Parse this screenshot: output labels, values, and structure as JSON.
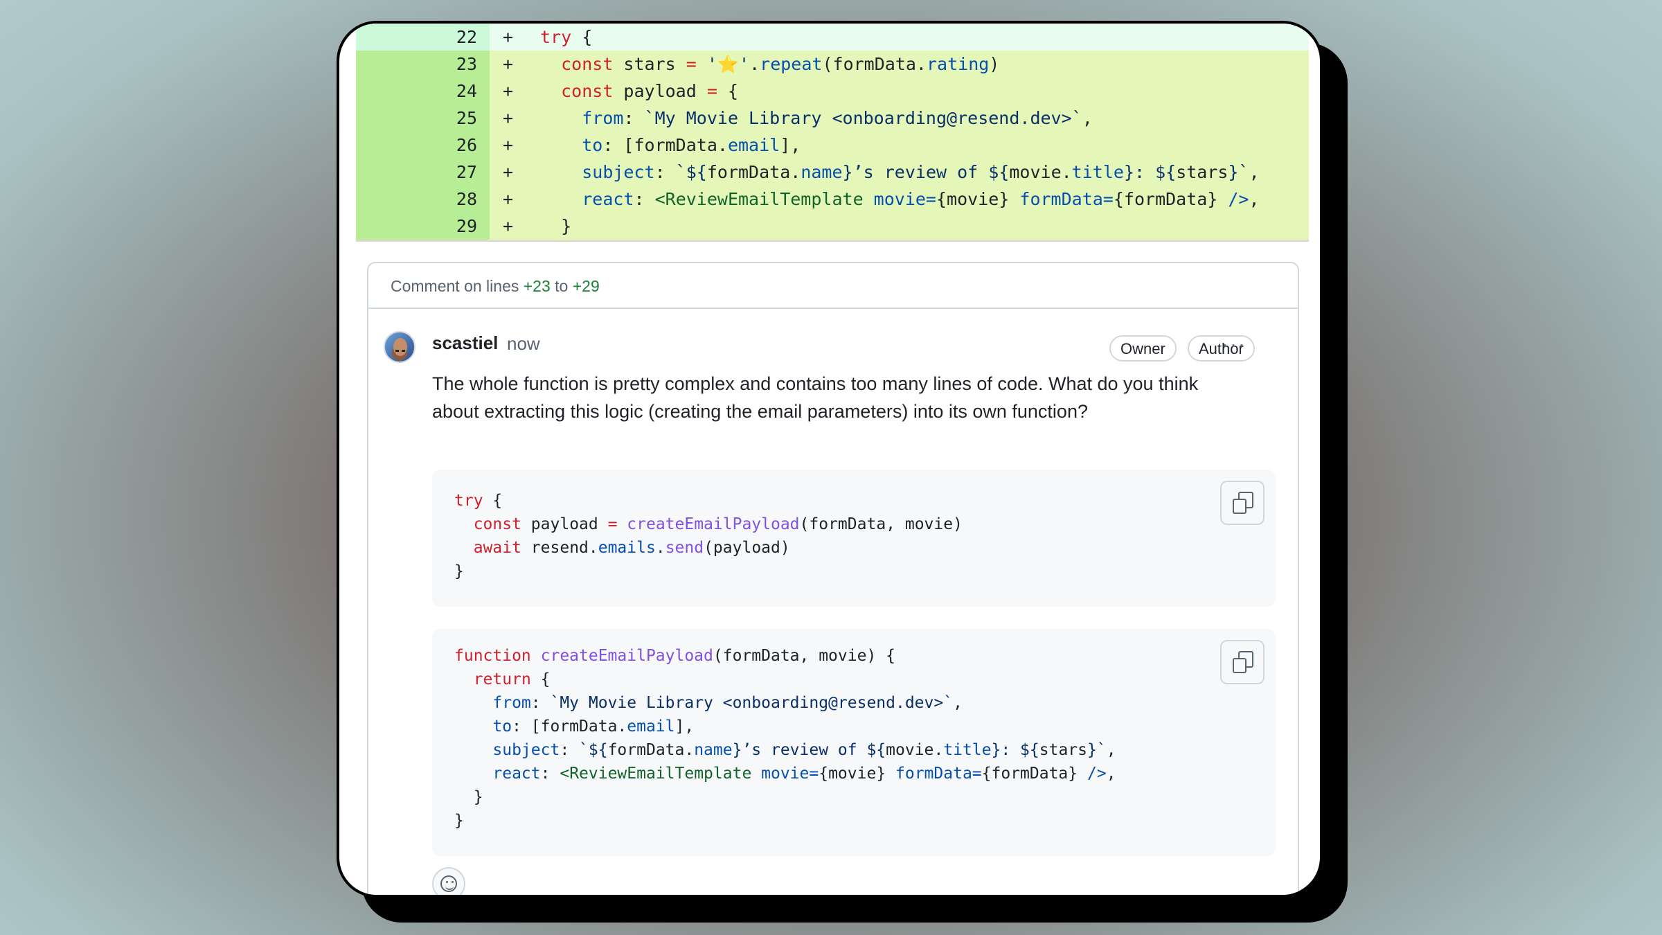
{
  "diff": {
    "lines": [
      {
        "num": "22",
        "sign": "+"
      },
      {
        "num": "23",
        "sign": "+"
      },
      {
        "num": "24",
        "sign": "+"
      },
      {
        "num": "25",
        "sign": "+"
      },
      {
        "num": "26",
        "sign": "+"
      },
      {
        "num": "27",
        "sign": "+"
      },
      {
        "num": "28",
        "sign": "+"
      },
      {
        "num": "29",
        "sign": "+"
      }
    ],
    "code": {
      "l22_kw": "try",
      "l22_rest": " {",
      "l23_kw": "const",
      "l23_a": " stars ",
      "l23_op": "=",
      "l23_str": " '⭐'",
      "l23_dot": ".",
      "l23_fn": "repeat",
      "l23_b": "(formData.",
      "l23_prop": "rating",
      "l23_c": ")",
      "l24_kw": "const",
      "l24_a": " payload ",
      "l24_op": "=",
      "l24_b": " {",
      "l25_prop": "from",
      "l25_a": ": ",
      "l25_str": "`My Movie Library <onboarding@resend.dev>`",
      "l25_b": ",",
      "l26_prop": "to",
      "l26_a": ": [formData.",
      "l26_prop2": "email",
      "l26_b": "],",
      "l27_prop": "subject",
      "l27_a": ": ",
      "l27_s1": "`${",
      "l27_b": "formData.",
      "l27_prop2": "name",
      "l27_s2": "}’s review of ${",
      "l27_c": "movie.",
      "l27_prop3": "title",
      "l27_s3": "}: ${",
      "l27_d": "stars",
      "l27_s4": "}`",
      "l27_e": ",",
      "l28_prop": "react",
      "l28_a": ": ",
      "l28_tag": "<ReviewEmailTemplate",
      "l28_attr1": " movie=",
      "l28_b": "{movie}",
      "l28_attr2": " formData=",
      "l28_c": "{formData}",
      "l28_close": " />",
      "l28_d": ",",
      "l29": "}"
    }
  },
  "thread": {
    "header_prefix": "Comment on lines ",
    "from_line": "+23",
    "to_word": " to ",
    "to_line": "+29",
    "author": "scastiel",
    "time": "now",
    "badge_owner": "Owner",
    "badge_author": "Author",
    "more": "···",
    "body": "The whole function is pretty complex and contains too many lines of code. What do you think about extracting this logic (creating the email parameters) into its own function?"
  },
  "snippet1": {
    "l1_kw": "try",
    "l1_rest": " {",
    "l2_kw": "const",
    "l2_a": " payload ",
    "l2_op": "=",
    "l2_fn": " createEmailPayload",
    "l2_b": "(formData, movie)",
    "l3_kw": "await",
    "l3_a": " resend.",
    "l3_prop": "emails",
    "l3_dot": ".",
    "l3_fn": "send",
    "l3_b": "(payload)",
    "l4": "}"
  },
  "snippet2": {
    "l1_kw": "function",
    "l1_fn": " createEmailPayload",
    "l1_rest": "(formData, movie) {",
    "l2_kw": "return",
    "l2_rest": " {",
    "l3_prop": "from",
    "l3_a": ": ",
    "l3_str": "`My Movie Library <onboarding@resend.dev>`",
    "l3_b": ",",
    "l4_prop": "to",
    "l4_a": ": [formData.",
    "l4_prop2": "email",
    "l4_b": "],",
    "l5_prop": "subject",
    "l5_a": ": ",
    "l5_s1": "`${",
    "l5_b": "formData.",
    "l5_prop2": "name",
    "l5_s2": "}’s review of ${",
    "l5_c": "movie.",
    "l5_prop3": "title",
    "l5_s3": "}: ${",
    "l5_d": "stars",
    "l5_s4": "}`",
    "l5_e": ",",
    "l6_prop": "react",
    "l6_a": ": ",
    "l6_tag": "<ReviewEmailTemplate",
    "l6_attr1": " movie=",
    "l6_b": "{movie}",
    "l6_attr2": " formData=",
    "l6_c": "{formData}",
    "l6_close": " />",
    "l6_d": ",",
    "l7": "}",
    "l8": "}"
  },
  "icons": {
    "copy": "copy-icon",
    "emoji": "smiley-icon",
    "more": "kebab-horizontal-icon"
  },
  "colors": {
    "keyword": "#cf222e",
    "string": "#0a3069",
    "property": "#0550ae",
    "function": "#8250df",
    "tag": "#116329",
    "added_line_bg": "#e5f7b8",
    "added_num_bg": "#b6ed95"
  }
}
